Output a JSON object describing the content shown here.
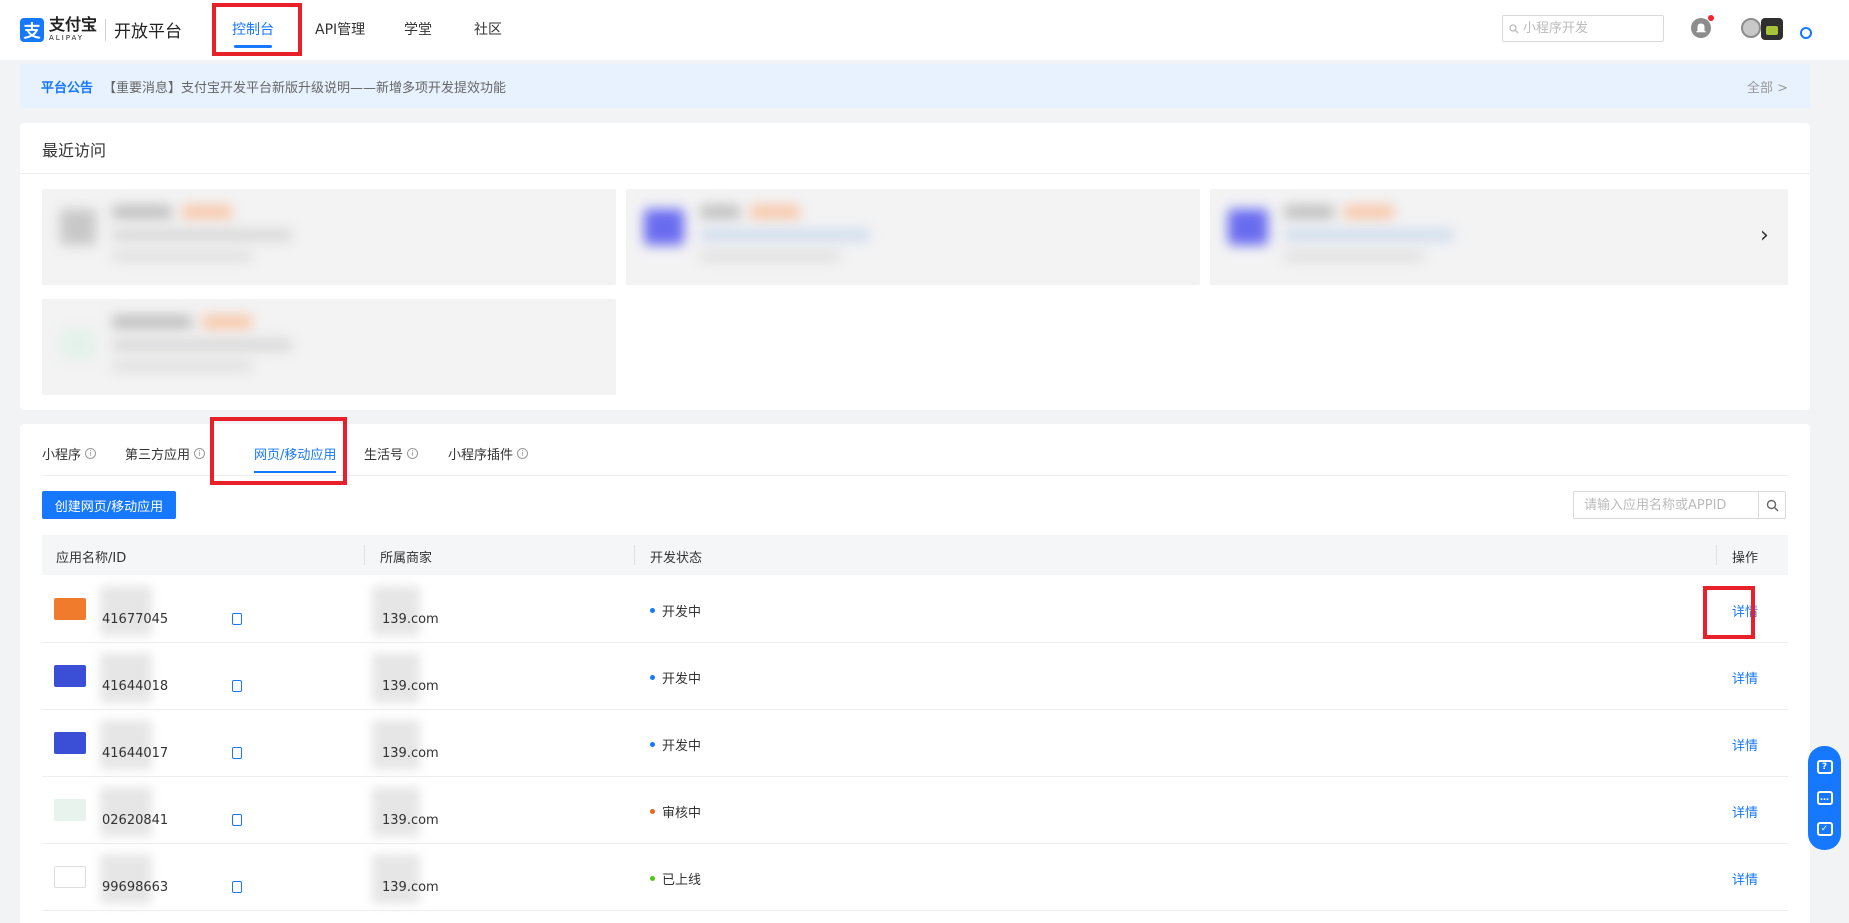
{
  "header": {
    "logo_cn": "支付宝",
    "logo_en": "ALIPAY",
    "platform": "开放平台",
    "nav": [
      {
        "label": "控制台",
        "active": true
      },
      {
        "label": "API管理",
        "active": false
      },
      {
        "label": "学堂",
        "active": false
      },
      {
        "label": "社区",
        "active": false
      }
    ],
    "search_placeholder": "小程序开发",
    "icons": [
      "bell-icon",
      "user-avatar",
      "settings-icon"
    ]
  },
  "notice": {
    "label": "平台公告",
    "text": "【重要消息】支付宝开发平台新版升级说明——新增多项开发提效功能",
    "all": "全部 >"
  },
  "recent": {
    "title": "最近访问",
    "next": "›"
  },
  "tabs": [
    {
      "label": "小程序",
      "info": true,
      "active": false
    },
    {
      "label": "第三方应用",
      "info": true,
      "active": false
    },
    {
      "label": "网页/移动应用",
      "info": false,
      "active": true
    },
    {
      "label": "生活号",
      "info": true,
      "active": false
    },
    {
      "label": "小程序插件",
      "info": true,
      "active": false
    }
  ],
  "toolbar": {
    "create_label": "创建网页/移动应用",
    "search_placeholder": "请输入应用名称或APPID"
  },
  "table": {
    "columns": [
      "应用名称/ID",
      "所属商家",
      "开发状态",
      "操作"
    ],
    "rows": [
      {
        "app_id": "41677045",
        "merchant": "139.com",
        "status": "开发中",
        "status_color": "#1677ff",
        "action": "详情",
        "thumb_color": "#f07b2c"
      },
      {
        "app_id": "41644018",
        "merchant": "139.com",
        "status": "开发中",
        "status_color": "#1677ff",
        "action": "详情",
        "thumb_color": "#3a4fd6"
      },
      {
        "app_id": "41644017",
        "merchant": "139.com",
        "status": "开发中",
        "status_color": "#1677ff",
        "action": "详情",
        "thumb_color": "#3a4fd6"
      },
      {
        "app_id": "02620841",
        "merchant": "139.com",
        "status": "审核中",
        "status_color": "#f5631b",
        "action": "详情",
        "thumb_color": "#e9f3ee"
      },
      {
        "app_id": "99698663",
        "merchant": "139.com",
        "status": "已上线",
        "status_color": "#52c41a",
        "action": "详情",
        "thumb_color": "#ffffff"
      }
    ]
  },
  "colors": {
    "primary": "#1677ff",
    "highlight": "#e8202a"
  }
}
